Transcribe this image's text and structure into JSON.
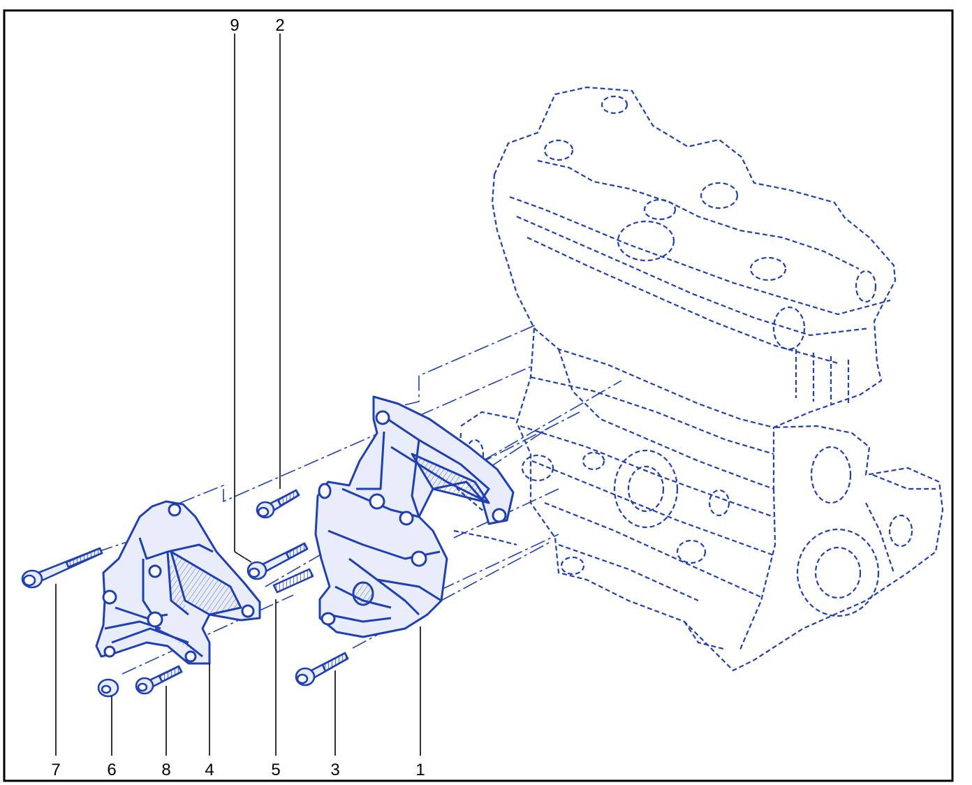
{
  "colors": {
    "line": "#1f3fb4",
    "fill": "#e9edfb",
    "frame": "#000000",
    "background": "#ffffff"
  },
  "callouts": {
    "c1": "1",
    "c2": "2",
    "c3": "3",
    "c4": "4",
    "c5": "5",
    "c6": "6",
    "c7": "7",
    "c8": "8",
    "c9": "9"
  }
}
